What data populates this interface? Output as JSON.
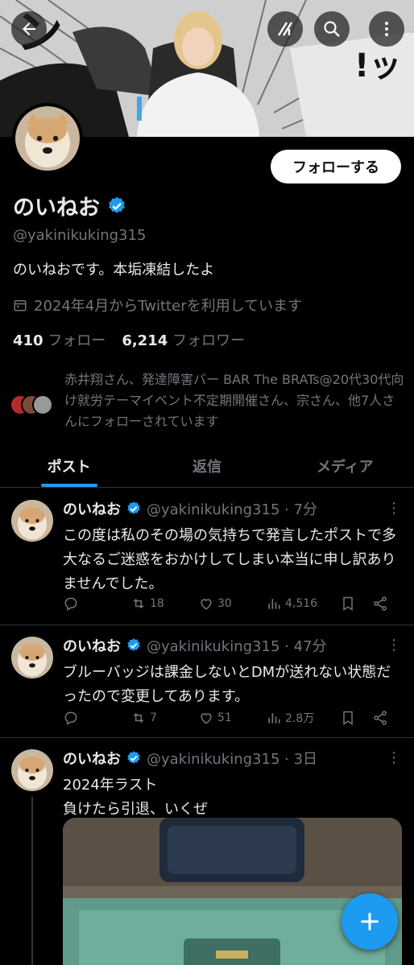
{
  "profile": {
    "name": "のいねお",
    "handle": "@yakinikuking315",
    "bio": "のいねおです。本垢凍結したよ",
    "joined": "2024年4月からTwitterを利用しています",
    "following_count": "410",
    "following_label": "フォロー",
    "followers_count": "6,214",
    "followers_label": "フォロワー",
    "follow_button": "フォローする",
    "followed_by": "赤井翔さん、発達障害バー BAR The BRATs@20代30代向け就労テーマイベント不定期開催さん、宗さん、他7人さんにフォローされています",
    "verified_color": "#1d9bf0"
  },
  "banner": {
    "sfx_left": "ン",
    "sfx_right": "!ッ"
  },
  "tabs": [
    {
      "label": "ポスト",
      "active": true
    },
    {
      "label": "返信",
      "active": false
    },
    {
      "label": "メディア",
      "active": false
    }
  ],
  "posts": [
    {
      "name": "のいねお",
      "meta": "@yakinikuking315 · 7分",
      "text": "この度は私のその場の気持ちで発言したポストで多大なるご迷惑をおかけしてしまい本当に申し訳ありませんでした。",
      "reposts": "18",
      "likes": "30",
      "views": "4,516"
    },
    {
      "name": "のいねお",
      "meta": "@yakinikuking315 · 47分",
      "text": "ブルーバッジは課金しないとDMが送れない状態だったので変更してあります。",
      "reposts": "7",
      "likes": "51",
      "views": "2.8万"
    },
    {
      "name": "のいねお",
      "meta": "@yakinikuking315 · 3日",
      "text_line1": "2024年ラスト",
      "text_line2": "負けたら引退、いくぜ"
    }
  ],
  "colors": {
    "accent": "#1d9bf0",
    "background": "#000000",
    "muted": "#71767b",
    "text": "#e7e9ea"
  }
}
